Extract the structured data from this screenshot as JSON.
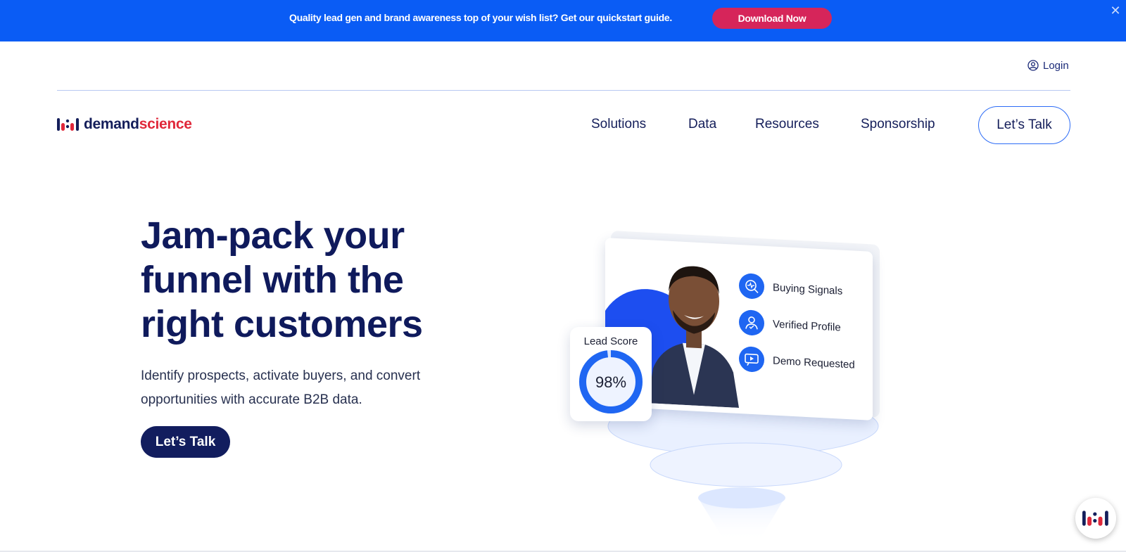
{
  "promo": {
    "text": "Quality lead gen and brand awareness top of your wish list? Get our quickstart guide.",
    "button": "Download Now",
    "close_icon": "close-icon",
    "background": "#0a5cf5",
    "button_color": "#d6255a"
  },
  "header": {
    "login": "Login",
    "login_icon": "user-circle-icon"
  },
  "brand": {
    "name_part1": "demand",
    "name_part2": "science",
    "primary_color": "#141e5a",
    "accent_color": "#e0283a"
  },
  "nav": {
    "items": [
      {
        "label": "Solutions"
      },
      {
        "label": "Data"
      },
      {
        "label": "Resources"
      },
      {
        "label": "Sponsorship"
      }
    ],
    "cta": "Let’s Talk"
  },
  "hero": {
    "title_line1": "Jam-pack your",
    "title_line2_bold": "funnel",
    "title_line2_rest": " with the",
    "title_line3": "right customers",
    "subtitle": "Identify prospects, activate buyers, and convert opportunities with accurate B2B data.",
    "cta": "Let’s Talk"
  },
  "illustration": {
    "lead_score_label": "Lead Score",
    "lead_score_value": "98%",
    "lead_score_fraction": 0.98,
    "features": [
      {
        "label": "Buying Signals",
        "icon": "signal-search-icon"
      },
      {
        "label": "Verified Profile",
        "icon": "verified-user-icon"
      },
      {
        "label": "Demo Requested",
        "icon": "video-demo-icon"
      }
    ]
  },
  "chat": {
    "icon": "brand-logo-chat-icon"
  }
}
